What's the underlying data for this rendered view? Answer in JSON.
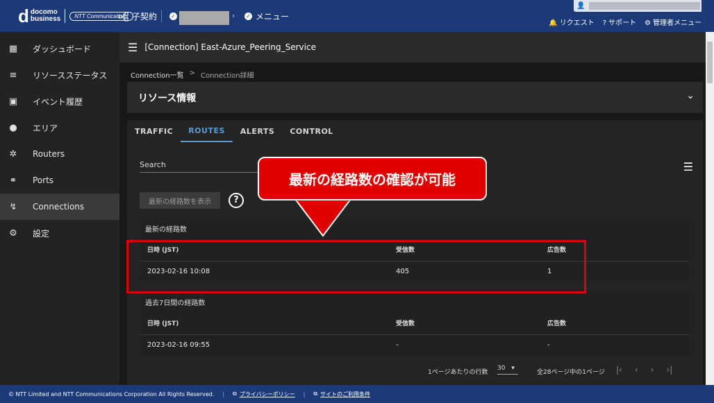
{
  "header": {
    "logo_docomo": "docomo",
    "logo_business": "business",
    "logo_ntt": "NTT Communications",
    "contract_label": "子契約",
    "menu_label": "メニュー",
    "links": [
      "リクエスト",
      "サポート",
      "管理者メニュー"
    ]
  },
  "sidebar": {
    "items": [
      {
        "label": "ダッシュボード",
        "icon": "grid-icon"
      },
      {
        "label": "リソースステータス",
        "icon": "status-icon"
      },
      {
        "label": "イベント履歴",
        "icon": "calendar-icon"
      },
      {
        "label": "エリア",
        "icon": "globe-icon"
      },
      {
        "label": "Routers",
        "icon": "router-icon"
      },
      {
        "label": "Ports",
        "icon": "port-icon"
      },
      {
        "label": "Connections",
        "icon": "connection-icon"
      },
      {
        "label": "設定",
        "icon": "gear-icon"
      }
    ]
  },
  "main": {
    "title": "[Connection] East-Azure_Peering_Service",
    "breadcrumb": [
      "Connection一覧",
      ">",
      "Connection詳細"
    ],
    "card_title": "リソース情報",
    "tabs": [
      "TRAFFIC",
      "ROUTES",
      "ALERTS",
      "CONTROL"
    ],
    "search_label": "Search",
    "show_latest_button": "最新の経路数を表示",
    "help_symbol": "?",
    "latest": {
      "label": "最新の経路数",
      "columns": [
        "日時 (JST)",
        "受信数",
        "広告数"
      ],
      "row": [
        "2023-02-16 10:08",
        "405",
        "1"
      ]
    },
    "past": {
      "label": "過去7日間の経路数",
      "columns": [
        "日時 (JST)",
        "受信数",
        "広告数"
      ],
      "row": [
        "2023-02-16 09:55",
        "-",
        "-"
      ]
    },
    "pager": {
      "rows_per_page_label": "1ページあたりの行数",
      "rows_per_page_value": "30",
      "page_info": "全28ページ中の1ページ"
    }
  },
  "annotation": {
    "callout_text": "最新の経路数の確認が可能",
    "accent": "#e00000"
  },
  "footer": {
    "copyright": "© NTT Limited and NTT Communications Corporation All Rights Reserved.",
    "privacy": "プライバシーポリシー",
    "terms": "サイトのご利用条件"
  }
}
